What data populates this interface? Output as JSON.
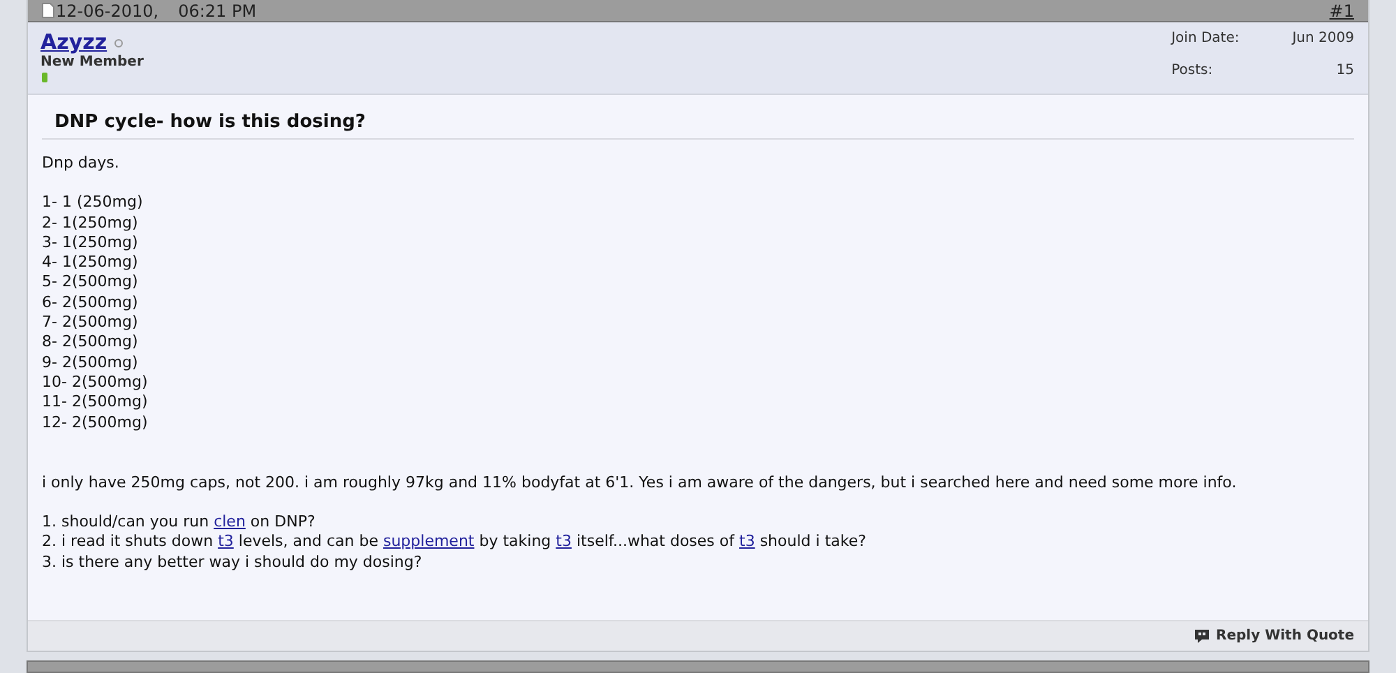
{
  "post": {
    "date": "12-06-2010,",
    "time": "06:21 PM",
    "number": "#1",
    "user": {
      "name": "Azyzz",
      "online": false,
      "rank": "New Member"
    },
    "stats": [
      {
        "label": "Join Date:",
        "value": "Jun 2009"
      },
      {
        "label": "Posts:",
        "value": "15"
      }
    ],
    "title": "DNP cycle- how is this dosing?",
    "intro": "Dnp days.",
    "schedule": [
      "1- 1 (250mg)",
      "2- 1(250mg)",
      "3- 1(250mg)",
      "4- 1(250mg)",
      "5- 2(500mg)",
      "6- 2(500mg)",
      "7- 2(500mg)",
      "8- 2(500mg)",
      "9- 2(500mg)",
      "10- 2(500mg)",
      "11- 2(500mg)",
      "12- 2(500mg)"
    ],
    "paragraph": "i only have 250mg caps, not 200. i am roughly 97kg and 11% bodyfat at 6'1. Yes i am aware of the dangers, but i searched here and need some more info.",
    "questions": [
      [
        {
          "kind": "text",
          "text": "1. should/can you run "
        },
        {
          "kind": "link",
          "text": "clen"
        },
        {
          "kind": "text",
          "text": " on DNP?"
        }
      ],
      [
        {
          "kind": "text",
          "text": "2. i read it shuts down "
        },
        {
          "kind": "link",
          "text": "t3"
        },
        {
          "kind": "text",
          "text": " levels, and can be "
        },
        {
          "kind": "link",
          "text": "supplement"
        },
        {
          "kind": "text",
          "text": " by taking "
        },
        {
          "kind": "link",
          "text": "t3"
        },
        {
          "kind": "text",
          "text": " itself...what doses of "
        },
        {
          "kind": "link",
          "text": "t3"
        },
        {
          "kind": "text",
          "text": " should i take?"
        }
      ],
      [
        {
          "kind": "text",
          "text": "3. is there any better way i should do my dosing?"
        }
      ]
    ],
    "reply_button": "Reply With Quote"
  }
}
